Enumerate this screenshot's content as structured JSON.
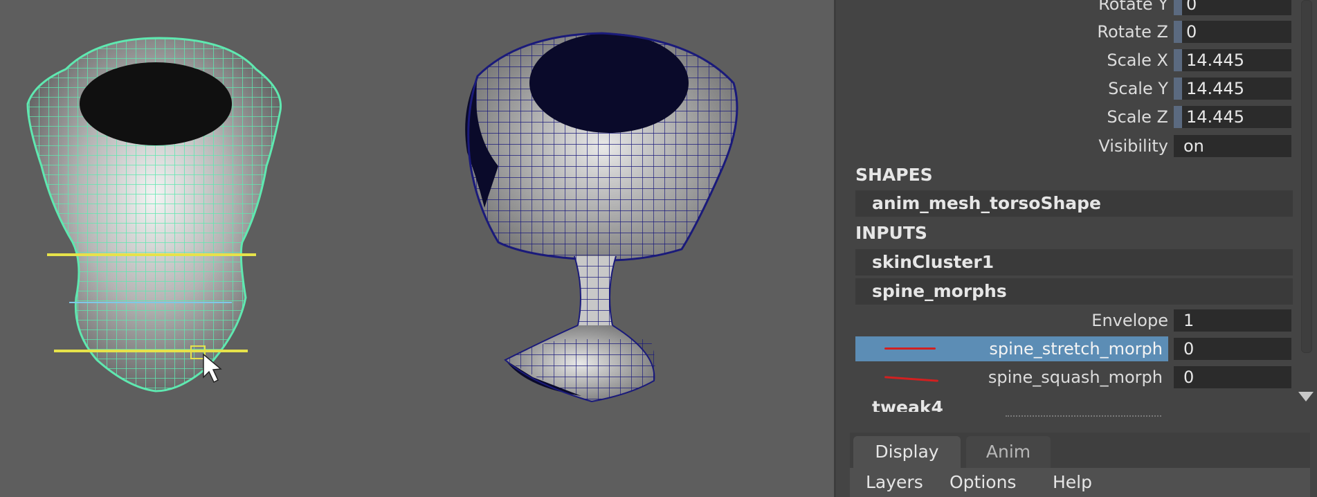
{
  "channel_box": {
    "attributes": [
      {
        "label": "Rotate Y",
        "value": "0",
        "keyed": true
      },
      {
        "label": "Rotate Z",
        "value": "0",
        "keyed": true
      },
      {
        "label": "Scale X",
        "value": "14.445",
        "keyed": true
      },
      {
        "label": "Scale Y",
        "value": "14.445",
        "keyed": true
      },
      {
        "label": "Scale Z",
        "value": "14.445",
        "keyed": true
      },
      {
        "label": "Visibility",
        "value": "on",
        "keyed": false
      }
    ],
    "shapes_header": "SHAPES",
    "shape_node": "anim_mesh_torsoShape",
    "inputs_header": "INPUTS",
    "input_nodes": [
      "skinCluster1",
      "spine_morphs"
    ],
    "envelope": {
      "label": "Envelope",
      "value": "1"
    },
    "morph_targets": [
      {
        "label": "spine_stretch_morph",
        "value": "0",
        "selected": true
      },
      {
        "label": "spine_squash_morph",
        "value": "0",
        "selected": false
      }
    ],
    "next_node": "tweak4"
  },
  "layer_editor": {
    "tabs": [
      "Display",
      "Anim"
    ],
    "active_tab": "Display",
    "menu": [
      "Layers",
      "Options",
      "Help"
    ]
  },
  "colors": {
    "viewport_bg": "#5e5e5e",
    "wireframe_selected": "#5fe8b0",
    "wireframe_dark": "#1a1a7a",
    "cluster_handle": "#e6e24a",
    "selection_highlight": "#5c8db5",
    "graph_indicator": "#d22020"
  }
}
